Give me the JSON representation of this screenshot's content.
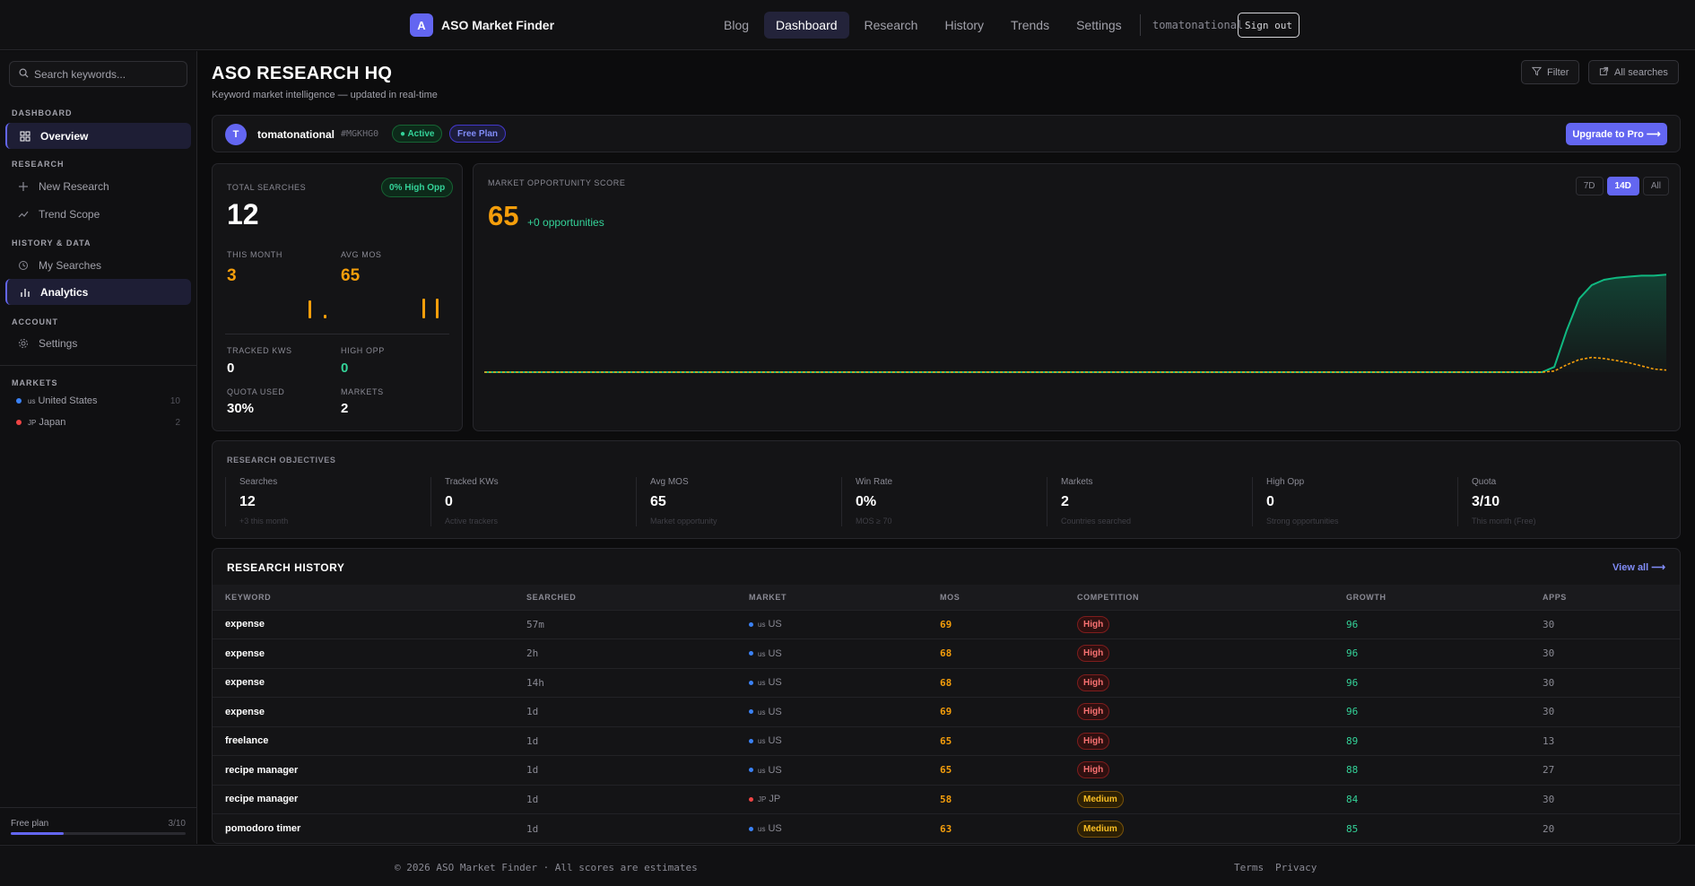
{
  "app": {
    "logo_letter": "A",
    "name": "ASO Market Finder"
  },
  "nav": {
    "items": [
      "Blog",
      "Dashboard",
      "Research",
      "History",
      "Trends",
      "Settings"
    ],
    "active": "Dashboard"
  },
  "user": {
    "name": "tomatonational",
    "signout_label": "Sign out"
  },
  "sidebar": {
    "search_placeholder": "Search keywords...",
    "sections": {
      "dashboard": "DASHBOARD",
      "research": "RESEARCH",
      "history": "HISTORY & DATA",
      "account": "ACCOUNT",
      "markets": "MARKETS"
    },
    "items": {
      "overview": "Overview",
      "new_research": "New Research",
      "trend_scope": "Trend Scope",
      "my_searches": "My Searches",
      "analytics": "Analytics",
      "settings": "Settings"
    },
    "markets": [
      {
        "code": "us",
        "name": "United States",
        "count": "10",
        "color": "#3b82f6"
      },
      {
        "code": "JP",
        "name": "Japan",
        "count": "2",
        "color": "#ef4444"
      }
    ],
    "plan": {
      "label": "Free plan",
      "quota": "3/10",
      "progress": 0.3
    }
  },
  "header": {
    "title": "ASO RESEARCH HQ",
    "subtitle": "Keyword market intelligence — updated in real-time",
    "filter_label": "Filter",
    "all_searches_label": "All searches"
  },
  "profile": {
    "initial": "T",
    "name": "tomatonational",
    "id": "#MGKHG0",
    "status": "● Active",
    "plan": "Free Plan",
    "upgrade_label": "Upgrade to Pro ⟶"
  },
  "stats": {
    "total_label": "TOTAL SEARCHES",
    "total_value": "12",
    "high_opp_badge": "0% High Opp",
    "this_month_label": "THIS MONTH",
    "this_month_value": "3",
    "avg_mos_label": "AVG MOS",
    "avg_mos_value": "65",
    "tracked_label": "TRACKED KWS",
    "tracked_value": "0",
    "high_opp_label": "HIGH OPP",
    "high_opp_value": "0",
    "quota_label": "QUOTA USED",
    "quota_value": "30%",
    "markets_label": "MARKETS",
    "markets_value": "2"
  },
  "opportunity": {
    "title": "MARKET OPPORTUNITY SCORE",
    "score": "65",
    "delta": "+0 opportunities",
    "ranges": [
      "7D",
      "14D",
      "All"
    ],
    "active_range": "14D"
  },
  "chart_data": {
    "type": "area",
    "title": "MARKET OPPORTUNITY SCORE",
    "series": [
      {
        "values": [
          0,
          0,
          0,
          0,
          0,
          0,
          0,
          0,
          0,
          0,
          0,
          0,
          0,
          0,
          0,
          0,
          0,
          0,
          0,
          0,
          0,
          0,
          0,
          0,
          0,
          0,
          0,
          0,
          0,
          0,
          0,
          0,
          0,
          0,
          0,
          0,
          0,
          0,
          0,
          0,
          0,
          0,
          0,
          0,
          0,
          0,
          0,
          0,
          0,
          0,
          0,
          0,
          0,
          0,
          0,
          0,
          0,
          0,
          0,
          0,
          0,
          0,
          0,
          0,
          0,
          0,
          0,
          0,
          0,
          0,
          0,
          0,
          0,
          0,
          0,
          0,
          0,
          0,
          0,
          0,
          0,
          0,
          0,
          0,
          0,
          0,
          5,
          40,
          70,
          83,
          88,
          90,
          91,
          92,
          92,
          93
        ],
        "color": "#10b981",
        "style": "solid-filled"
      },
      {
        "values": [
          0,
          0,
          0,
          0,
          0,
          0,
          0,
          0,
          0,
          0,
          0,
          0,
          0,
          0,
          0,
          0,
          0,
          0,
          0,
          0,
          0,
          0,
          0,
          0,
          0,
          0,
          0,
          0,
          0,
          0,
          0,
          0,
          0,
          0,
          0,
          0,
          0,
          0,
          0,
          0,
          0,
          0,
          0,
          0,
          0,
          0,
          0,
          0,
          0,
          0,
          0,
          0,
          0,
          0,
          0,
          0,
          0,
          0,
          0,
          0,
          0,
          0,
          0,
          0,
          0,
          0,
          0,
          0,
          0,
          0,
          0,
          0,
          0,
          0,
          0,
          0,
          0,
          0,
          0,
          0,
          0,
          0,
          0,
          0,
          0,
          0,
          1,
          7,
          12,
          14,
          13,
          11,
          9,
          6,
          3,
          2
        ],
        "color": "#f59e0b",
        "style": "dashed"
      }
    ],
    "ylim": [
      0,
      100
    ],
    "grid": false
  },
  "objectives": {
    "title": "RESEARCH OBJECTIVES",
    "items": [
      {
        "label": "Searches",
        "value": "12",
        "sub": "+3 this month"
      },
      {
        "label": "Tracked KWs",
        "value": "0",
        "sub": "Active trackers"
      },
      {
        "label": "Avg MOS",
        "value": "65",
        "sub": "Market opportunity"
      },
      {
        "label": "Win Rate",
        "value": "0%",
        "sub": "MOS ≥ 70"
      },
      {
        "label": "Markets",
        "value": "2",
        "sub": "Countries searched"
      },
      {
        "label": "High Opp",
        "value": "0",
        "sub": "Strong opportunities"
      },
      {
        "label": "Quota",
        "value": "3/10",
        "sub": "This month (Free)"
      }
    ]
  },
  "history": {
    "title": "RESEARCH HISTORY",
    "view_all": "View all ⟶",
    "columns": [
      "KEYWORD",
      "SEARCHED",
      "MARKET",
      "MOS",
      "COMPETITION",
      "GROWTH",
      "APPS"
    ],
    "rows": [
      {
        "keyword": "expense",
        "searched": "57m",
        "market_code": "us",
        "market": "US",
        "market_color": "#3b82f6",
        "mos": "69",
        "competition": "High",
        "growth": "96",
        "apps": "30"
      },
      {
        "keyword": "expense",
        "searched": "2h",
        "market_code": "us",
        "market": "US",
        "market_color": "#3b82f6",
        "mos": "68",
        "competition": "High",
        "growth": "96",
        "apps": "30"
      },
      {
        "keyword": "expense",
        "searched": "14h",
        "market_code": "us",
        "market": "US",
        "market_color": "#3b82f6",
        "mos": "68",
        "competition": "High",
        "growth": "96",
        "apps": "30"
      },
      {
        "keyword": "expense",
        "searched": "1d",
        "market_code": "us",
        "market": "US",
        "market_color": "#3b82f6",
        "mos": "69",
        "competition": "High",
        "growth": "96",
        "apps": "30"
      },
      {
        "keyword": "freelance",
        "searched": "1d",
        "market_code": "us",
        "market": "US",
        "market_color": "#3b82f6",
        "mos": "65",
        "competition": "High",
        "growth": "89",
        "apps": "13"
      },
      {
        "keyword": "recipe manager",
        "searched": "1d",
        "market_code": "us",
        "market": "US",
        "market_color": "#3b82f6",
        "mos": "65",
        "competition": "High",
        "growth": "88",
        "apps": "27"
      },
      {
        "keyword": "recipe manager",
        "searched": "1d",
        "market_code": "JP",
        "market": "JP",
        "market_color": "#ef4444",
        "mos": "58",
        "competition": "Medium",
        "growth": "84",
        "apps": "30"
      },
      {
        "keyword": "pomodoro timer",
        "searched": "1d",
        "market_code": "us",
        "market": "US",
        "market_color": "#3b82f6",
        "mos": "63",
        "competition": "Medium",
        "growth": "85",
        "apps": "20"
      }
    ]
  },
  "footer": {
    "copyright": "© 2026 ASO Market Finder · All scores are estimates",
    "terms": "Terms",
    "privacy": "Privacy"
  }
}
